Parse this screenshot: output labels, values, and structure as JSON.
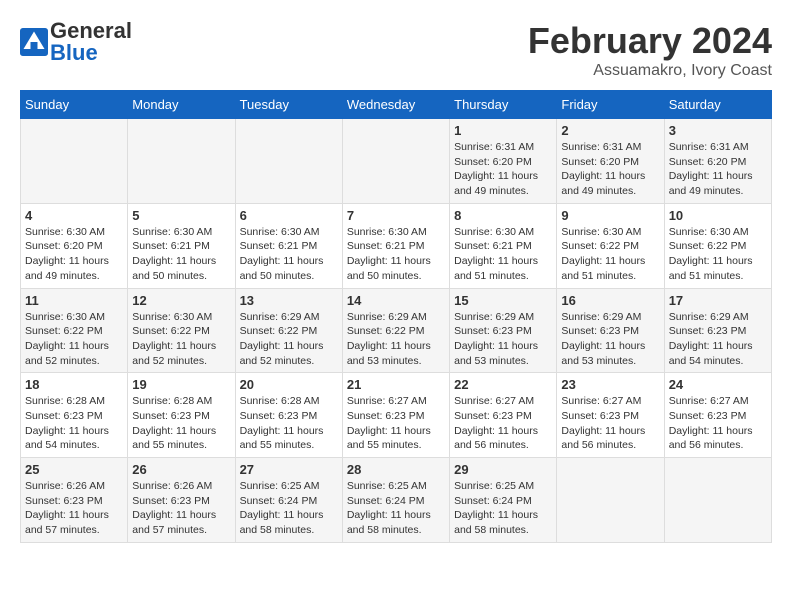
{
  "header": {
    "logo_general": "General",
    "logo_blue": "Blue",
    "title": "February 2024",
    "subtitle": "Assuamakro, Ivory Coast"
  },
  "weekdays": [
    "Sunday",
    "Monday",
    "Tuesday",
    "Wednesday",
    "Thursday",
    "Friday",
    "Saturday"
  ],
  "weeks": [
    [
      {
        "day": "",
        "info": ""
      },
      {
        "day": "",
        "info": ""
      },
      {
        "day": "",
        "info": ""
      },
      {
        "day": "",
        "info": ""
      },
      {
        "day": "1",
        "info": "Sunrise: 6:31 AM\nSunset: 6:20 PM\nDaylight: 11 hours\nand 49 minutes."
      },
      {
        "day": "2",
        "info": "Sunrise: 6:31 AM\nSunset: 6:20 PM\nDaylight: 11 hours\nand 49 minutes."
      },
      {
        "day": "3",
        "info": "Sunrise: 6:31 AM\nSunset: 6:20 PM\nDaylight: 11 hours\nand 49 minutes."
      }
    ],
    [
      {
        "day": "4",
        "info": "Sunrise: 6:30 AM\nSunset: 6:20 PM\nDaylight: 11 hours\nand 49 minutes."
      },
      {
        "day": "5",
        "info": "Sunrise: 6:30 AM\nSunset: 6:21 PM\nDaylight: 11 hours\nand 50 minutes."
      },
      {
        "day": "6",
        "info": "Sunrise: 6:30 AM\nSunset: 6:21 PM\nDaylight: 11 hours\nand 50 minutes."
      },
      {
        "day": "7",
        "info": "Sunrise: 6:30 AM\nSunset: 6:21 PM\nDaylight: 11 hours\nand 50 minutes."
      },
      {
        "day": "8",
        "info": "Sunrise: 6:30 AM\nSunset: 6:21 PM\nDaylight: 11 hours\nand 51 minutes."
      },
      {
        "day": "9",
        "info": "Sunrise: 6:30 AM\nSunset: 6:22 PM\nDaylight: 11 hours\nand 51 minutes."
      },
      {
        "day": "10",
        "info": "Sunrise: 6:30 AM\nSunset: 6:22 PM\nDaylight: 11 hours\nand 51 minutes."
      }
    ],
    [
      {
        "day": "11",
        "info": "Sunrise: 6:30 AM\nSunset: 6:22 PM\nDaylight: 11 hours\nand 52 minutes."
      },
      {
        "day": "12",
        "info": "Sunrise: 6:30 AM\nSunset: 6:22 PM\nDaylight: 11 hours\nand 52 minutes."
      },
      {
        "day": "13",
        "info": "Sunrise: 6:29 AM\nSunset: 6:22 PM\nDaylight: 11 hours\nand 52 minutes."
      },
      {
        "day": "14",
        "info": "Sunrise: 6:29 AM\nSunset: 6:22 PM\nDaylight: 11 hours\nand 53 minutes."
      },
      {
        "day": "15",
        "info": "Sunrise: 6:29 AM\nSunset: 6:23 PM\nDaylight: 11 hours\nand 53 minutes."
      },
      {
        "day": "16",
        "info": "Sunrise: 6:29 AM\nSunset: 6:23 PM\nDaylight: 11 hours\nand 53 minutes."
      },
      {
        "day": "17",
        "info": "Sunrise: 6:29 AM\nSunset: 6:23 PM\nDaylight: 11 hours\nand 54 minutes."
      }
    ],
    [
      {
        "day": "18",
        "info": "Sunrise: 6:28 AM\nSunset: 6:23 PM\nDaylight: 11 hours\nand 54 minutes."
      },
      {
        "day": "19",
        "info": "Sunrise: 6:28 AM\nSunset: 6:23 PM\nDaylight: 11 hours\nand 55 minutes."
      },
      {
        "day": "20",
        "info": "Sunrise: 6:28 AM\nSunset: 6:23 PM\nDaylight: 11 hours\nand 55 minutes."
      },
      {
        "day": "21",
        "info": "Sunrise: 6:27 AM\nSunset: 6:23 PM\nDaylight: 11 hours\nand 55 minutes."
      },
      {
        "day": "22",
        "info": "Sunrise: 6:27 AM\nSunset: 6:23 PM\nDaylight: 11 hours\nand 56 minutes."
      },
      {
        "day": "23",
        "info": "Sunrise: 6:27 AM\nSunset: 6:23 PM\nDaylight: 11 hours\nand 56 minutes."
      },
      {
        "day": "24",
        "info": "Sunrise: 6:27 AM\nSunset: 6:23 PM\nDaylight: 11 hours\nand 56 minutes."
      }
    ],
    [
      {
        "day": "25",
        "info": "Sunrise: 6:26 AM\nSunset: 6:23 PM\nDaylight: 11 hours\nand 57 minutes."
      },
      {
        "day": "26",
        "info": "Sunrise: 6:26 AM\nSunset: 6:23 PM\nDaylight: 11 hours\nand 57 minutes."
      },
      {
        "day": "27",
        "info": "Sunrise: 6:25 AM\nSunset: 6:24 PM\nDaylight: 11 hours\nand 58 minutes."
      },
      {
        "day": "28",
        "info": "Sunrise: 6:25 AM\nSunset: 6:24 PM\nDaylight: 11 hours\nand 58 minutes."
      },
      {
        "day": "29",
        "info": "Sunrise: 6:25 AM\nSunset: 6:24 PM\nDaylight: 11 hours\nand 58 minutes."
      },
      {
        "day": "",
        "info": ""
      },
      {
        "day": "",
        "info": ""
      }
    ]
  ]
}
